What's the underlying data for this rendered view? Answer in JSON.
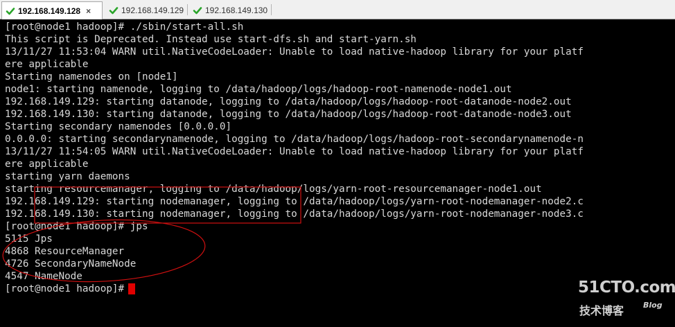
{
  "tabs": [
    {
      "label": "192.168.149.128",
      "active": true,
      "close": "×"
    },
    {
      "label": "192.168.149.129",
      "active": false
    },
    {
      "label": "192.168.149.130",
      "active": false
    }
  ],
  "terminal": {
    "lines": [
      "[root@node1 hadoop]# ./sbin/start-all.sh",
      "This script is Deprecated. Instead use start-dfs.sh and start-yarn.sh",
      "13/11/27 11:53:04 WARN util.NativeCodeLoader: Unable to load native-hadoop library for your platf",
      "ere applicable",
      "Starting namenodes on [node1]",
      "node1: starting namenode, logging to /data/hadoop/logs/hadoop-root-namenode-node1.out",
      "192.168.149.129: starting datanode, logging to /data/hadoop/logs/hadoop-root-datanode-node2.out",
      "192.168.149.130: starting datanode, logging to /data/hadoop/logs/hadoop-root-datanode-node3.out",
      "Starting secondary namenodes [0.0.0.0]",
      "0.0.0.0: starting secondarynamenode, logging to /data/hadoop/logs/hadoop-root-secondarynamenode-n",
      "13/11/27 11:54:05 WARN util.NativeCodeLoader: Unable to load native-hadoop library for your platf",
      "ere applicable",
      "starting yarn daemons",
      "starting resourcemanager, logging to /data/hadoop/logs/yarn-root-resourcemanager-node1.out",
      "192.168.149.129: starting nodemanager, logging to /data/hadoop/logs/yarn-root-nodemanager-node2.c",
      "192.168.149.130: starting nodemanager, logging to /data/hadoop/logs/yarn-root-nodemanager-node3.c",
      "[root@node1 hadoop]# jps",
      "5115 Jps",
      "4868 ResourceManager",
      "4726 SecondaryNameNode",
      "4547 NameNode"
    ],
    "prompt": "[root@node1 hadoop]#"
  },
  "watermark": {
    "main": "51CTO.com",
    "sub": "技术博客",
    "tag": "Blog"
  },
  "colors": {
    "annotation": "#d01010",
    "cursor": "#e00000",
    "text": "#d8d8d8",
    "ok-check": "#2aa52a"
  }
}
